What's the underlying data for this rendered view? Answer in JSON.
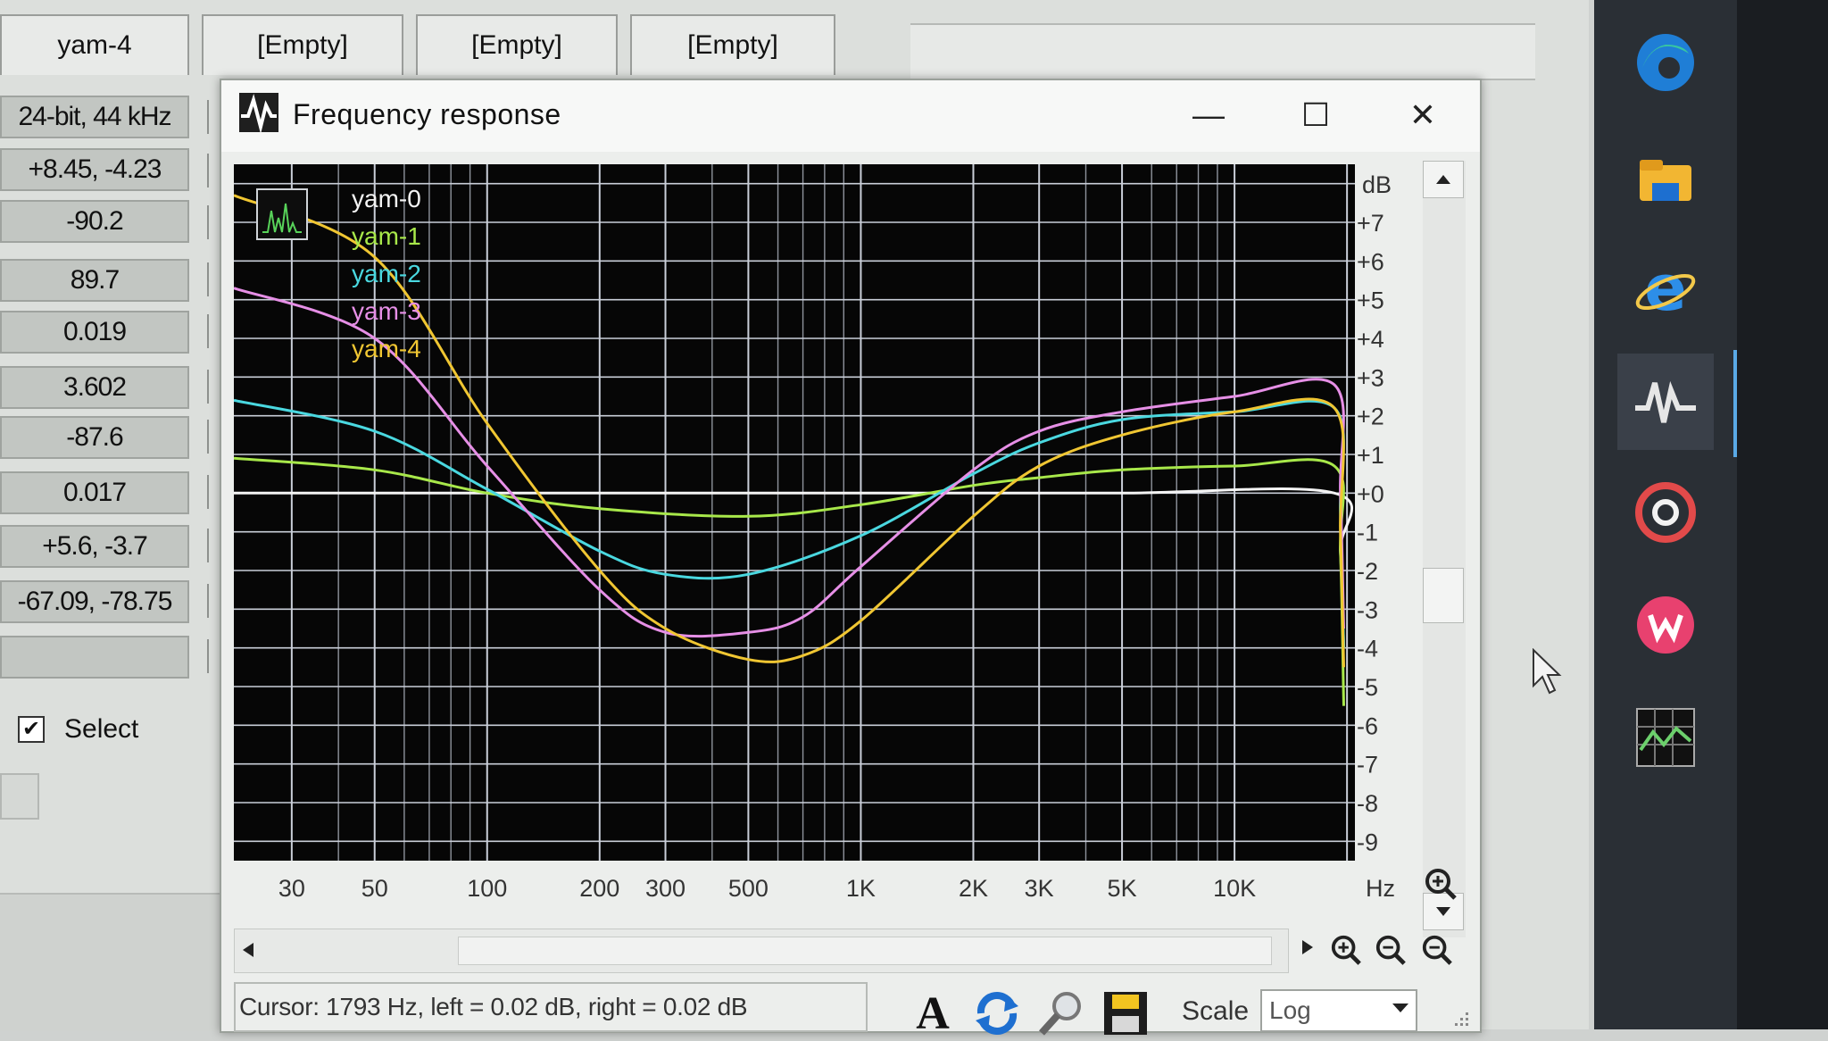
{
  "background_app": {
    "tabs": [
      "yam-4",
      "[Empty]",
      "[Empty]",
      "[Empty]"
    ],
    "stats": [
      "24-bit, 44 kHz",
      "+8.45, -4.23",
      "-90.2",
      "89.7",
      "0.019",
      "3.602",
      "-87.6",
      "0.017",
      "+5.6, -3.7",
      "-67.09, -78.75",
      ""
    ],
    "select_label": "Select",
    "select_mark": "✔"
  },
  "dialog": {
    "title": "Frequency response",
    "minimize": "—",
    "maximize": "☐",
    "close": "✕",
    "status_text": "Cursor:  1793 Hz,  left = 0.02 dB,  right = 0.02 dB",
    "scale_label": "Scale",
    "scale_value": "Log",
    "font_button": "A"
  },
  "chart_data": {
    "type": "line",
    "xscale": "log",
    "xlim": [
      21,
      21000
    ],
    "ylim": [
      -9.5,
      8.5
    ],
    "grid": true,
    "legend_position": "top-left",
    "ylabel": "dB",
    "xlabel": "Hz",
    "y_ticks": [
      "+7",
      "+6",
      "+5",
      "+4",
      "+3",
      "+2",
      "+1",
      "+0",
      "-1",
      "-2",
      "-3",
      "-4",
      "-5",
      "-6",
      "-7",
      "-8",
      "-9"
    ],
    "y_tick_values": [
      7,
      6,
      5,
      4,
      3,
      2,
      1,
      0,
      -1,
      -2,
      -3,
      -4,
      -5,
      -6,
      -7,
      -8,
      -9
    ],
    "x_ticks": [
      "30",
      "50",
      "100",
      "200",
      "300",
      "500",
      "1K",
      "2K",
      "3K",
      "5K",
      "10K"
    ],
    "x_tick_values": [
      30,
      50,
      100,
      200,
      300,
      500,
      1000,
      2000,
      3000,
      5000,
      10000
    ],
    "series": [
      {
        "name": "yam-0",
        "color": "#f4f4f4",
        "points": [
          [
            21,
            0
          ],
          [
            100,
            0
          ],
          [
            1000,
            0
          ],
          [
            5000,
            0
          ],
          [
            18500,
            0
          ],
          [
            19200,
            -1.5
          ],
          [
            19600,
            -4
          ]
        ]
      },
      {
        "name": "yam-1",
        "color": "#a8e84a",
        "points": [
          [
            21,
            0.9
          ],
          [
            50,
            0.6
          ],
          [
            100,
            0
          ],
          [
            200,
            -0.4
          ],
          [
            500,
            -0.6
          ],
          [
            1000,
            -0.3
          ],
          [
            2000,
            0.2
          ],
          [
            3000,
            0.4
          ],
          [
            5000,
            0.6
          ],
          [
            10000,
            0.7
          ],
          [
            18500,
            0.7
          ],
          [
            19200,
            -1.5
          ],
          [
            19600,
            -5.5
          ]
        ]
      },
      {
        "name": "yam-2",
        "color": "#4ad8e0",
        "points": [
          [
            21,
            2.4
          ],
          [
            50,
            1.6
          ],
          [
            100,
            0.1
          ],
          [
            200,
            -1.5
          ],
          [
            300,
            -2.1
          ],
          [
            500,
            -2.1
          ],
          [
            1000,
            -1.1
          ],
          [
            2000,
            0.5
          ],
          [
            3000,
            1.3
          ],
          [
            5000,
            1.9
          ],
          [
            10000,
            2.1
          ],
          [
            18500,
            2.2
          ],
          [
            19200,
            -0.5
          ],
          [
            19600,
            -4
          ]
        ]
      },
      {
        "name": "yam-3",
        "color": "#e68fe6",
        "points": [
          [
            21,
            5.3
          ],
          [
            50,
            4
          ],
          [
            100,
            0.7
          ],
          [
            200,
            -2.5
          ],
          [
            300,
            -3.6
          ],
          [
            500,
            -3.6
          ],
          [
            700,
            -3.2
          ],
          [
            1000,
            -1.9
          ],
          [
            2000,
            0.6
          ],
          [
            3000,
            1.6
          ],
          [
            5000,
            2.1
          ],
          [
            10000,
            2.5
          ],
          [
            18500,
            2.8
          ],
          [
            19200,
            0
          ],
          [
            19600,
            -3.5
          ]
        ]
      },
      {
        "name": "yam-4",
        "color": "#f0c632",
        "points": [
          [
            21,
            7.7
          ],
          [
            50,
            6.1
          ],
          [
            100,
            1.8
          ],
          [
            200,
            -2
          ],
          [
            300,
            -3.5
          ],
          [
            500,
            -4.3
          ],
          [
            700,
            -4.2
          ],
          [
            1000,
            -3.3
          ],
          [
            2000,
            -0.6
          ],
          [
            3000,
            0.7
          ],
          [
            5000,
            1.5
          ],
          [
            10000,
            2.1
          ],
          [
            18500,
            2.2
          ],
          [
            19200,
            -1
          ],
          [
            19600,
            -4.5
          ]
        ]
      }
    ]
  }
}
